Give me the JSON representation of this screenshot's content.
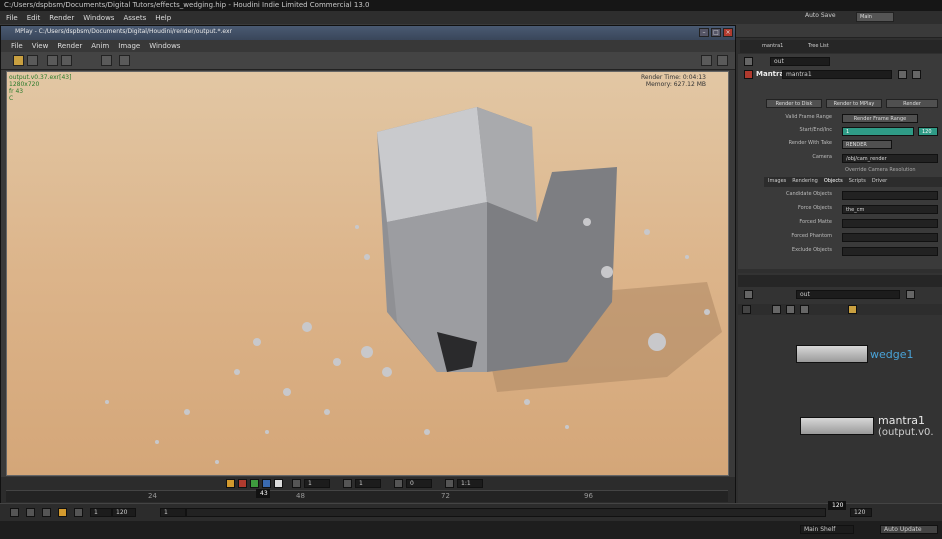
{
  "os": {
    "title": "C:/Users/dspbsm/Documents/Digital Tutors/effects_wedging.hip - Houdini Indie Limited Commercial 13.0"
  },
  "houdini": {
    "menu": [
      "File",
      "Edit",
      "Render",
      "Windows",
      "Assets",
      "Help"
    ],
    "auto_save": "Auto Save",
    "desktop": "Main"
  },
  "mplay": {
    "title": "MPlay - C:/Users/dspbsm/Documents/Digital/Houdini/render/output.*.exr",
    "menu": [
      "File",
      "View",
      "Render",
      "Anim",
      "Image",
      "Windows"
    ],
    "info": [
      "output.v0.37.exr[43]",
      "1280x720",
      "fr 43",
      "C"
    ],
    "stats": [
      "Render Time: 0:04:13",
      "Memory: 627.12 MB"
    ],
    "frame_current": "1",
    "frame_b": "1",
    "frame_c": "0",
    "zoom": "1:1",
    "timeline_marker": "43",
    "tick_labels": [
      "24",
      "48",
      "72",
      "96"
    ],
    "play_frame": "43",
    "range_start": "1",
    "range_end": "120",
    "step": "24"
  },
  "props": {
    "tabs": [
      "mantra1",
      "Tree List"
    ],
    "path": "out",
    "node_type": "Mantra",
    "node_name": "mantra1",
    "buttons": [
      "Render to Disk",
      "Render to MPlay",
      "Render"
    ],
    "rows": [
      {
        "label": "Valid Frame Range",
        "value": "Render Frame Range"
      },
      {
        "label": "Start/End/Inc",
        "value": "1",
        "value2": "120"
      },
      {
        "label": "Render With Take",
        "value": "RENDER"
      },
      {
        "label": "Camera",
        "value": "/obj/cam_render"
      },
      {
        "label": "",
        "value": "Override Camera Resolution"
      }
    ],
    "subtabs": [
      "Images",
      "Rendering",
      "Objects",
      "Scripts",
      "Driver"
    ],
    "object_rows": [
      {
        "label": "Candidate Objects",
        "value": ""
      },
      {
        "label": "Force Objects",
        "value": "the_cm"
      },
      {
        "label": "Forced Matte",
        "value": ""
      },
      {
        "label": "Forced Phantom",
        "value": ""
      },
      {
        "label": "Exclude Objects",
        "value": ""
      }
    ]
  },
  "network": {
    "path": "out",
    "nodes": [
      {
        "name": "wedge1",
        "color": "#4aa3d8"
      },
      {
        "name": "mantra1",
        "sub": "(output.v0.",
        "color": "#e8e8e8"
      }
    ]
  },
  "playbar": {
    "frame_start": "1",
    "frame_end": "120",
    "global_end": "120",
    "global_end2": "120"
  },
  "status": {
    "update_mode": "Auto Update",
    "shelf_label": "Main Shelf"
  },
  "colors": {
    "accent_orange": "#d39a2e",
    "green_bar": "#2f9b86",
    "title_blue": "#4a5a72"
  }
}
